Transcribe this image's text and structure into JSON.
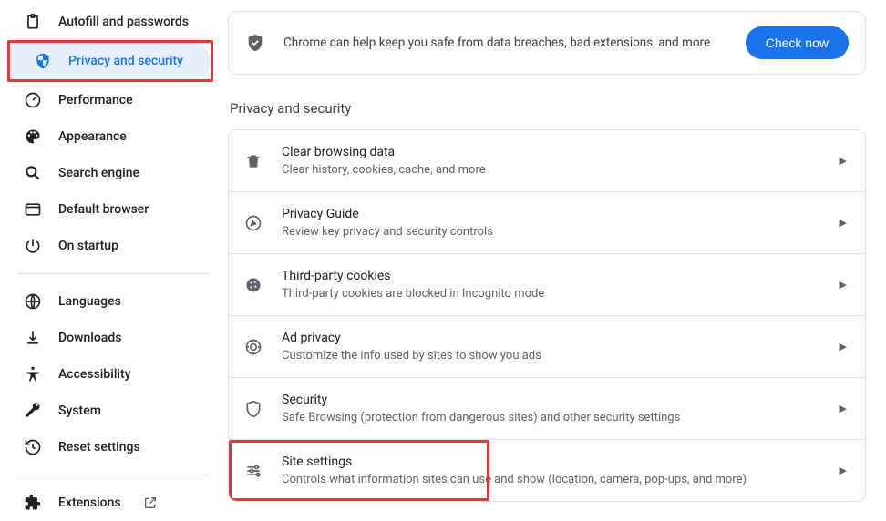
{
  "sidebar": {
    "items": [
      {
        "label": "Autofill and passwords"
      },
      {
        "label": "Privacy and security"
      },
      {
        "label": "Performance"
      },
      {
        "label": "Appearance"
      },
      {
        "label": "Search engine"
      },
      {
        "label": "Default browser"
      },
      {
        "label": "On startup"
      }
    ],
    "items2": [
      {
        "label": "Languages"
      },
      {
        "label": "Downloads"
      },
      {
        "label": "Accessibility"
      },
      {
        "label": "System"
      },
      {
        "label": "Reset settings"
      }
    ],
    "items3": [
      {
        "label": "Extensions"
      }
    ]
  },
  "banner": {
    "text": "Chrome can help keep you safe from data breaches, bad extensions, and more",
    "button": "Check now"
  },
  "section_title": "Privacy and security",
  "rows": [
    {
      "title": "Clear browsing data",
      "sub": "Clear history, cookies, cache, and more"
    },
    {
      "title": "Privacy Guide",
      "sub": "Review key privacy and security controls"
    },
    {
      "title": "Third-party cookies",
      "sub": "Third-party cookies are blocked in Incognito mode"
    },
    {
      "title": "Ad privacy",
      "sub": "Customize the info used by sites to show you ads"
    },
    {
      "title": "Security",
      "sub": "Safe Browsing (protection from dangerous sites) and other security settings"
    },
    {
      "title": "Site settings",
      "sub": "Controls what information sites can use and show (location, camera, pop-ups, and more)"
    }
  ]
}
